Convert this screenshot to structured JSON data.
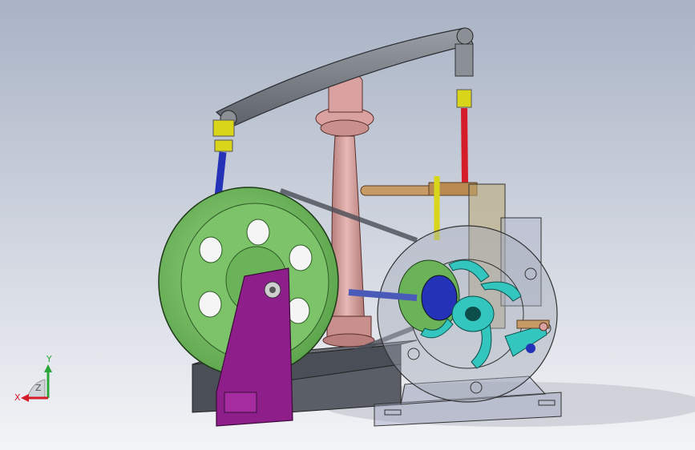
{
  "colors": {
    "background_top": "#aab4c6",
    "background_bottom": "#f2f3f6",
    "base_dark": "#545861",
    "flywheel_green": "#7cc36a",
    "bracket_purple": "#8e1f8a",
    "column_pink": "#d9a2a0",
    "beam_gray": "#7a7f86",
    "rod_blue": "#2432b8",
    "rod_red": "#d51d2a",
    "rod_yellow": "#d9d51a",
    "impeller_cyan": "#33c6bf",
    "arm_tan": "#c79a66"
  },
  "triad": {
    "x_label": "X",
    "y_label": "Y",
    "z_label": "Z"
  }
}
